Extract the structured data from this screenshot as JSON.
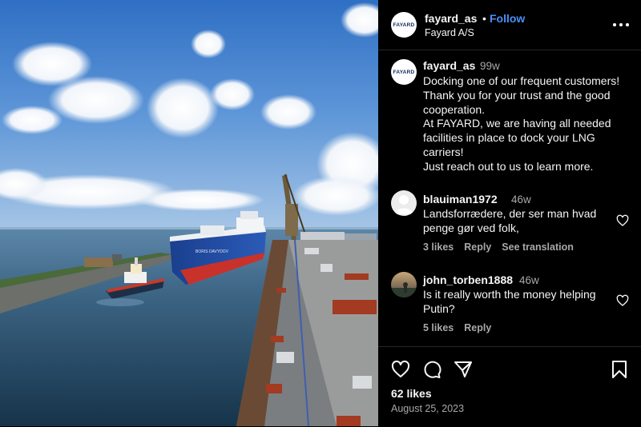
{
  "post": {
    "username": "fayard_as",
    "separator": "•",
    "follow_label": "Follow",
    "subtitle": "Fayard A/S",
    "avatar_text": "FAYARD",
    "photo_ship_name": "BORIS DAVYDOV"
  },
  "caption": {
    "username": "fayard_as",
    "time": "99w",
    "lines": [
      "Docking one of our frequent customers!",
      "Thank you for your trust and the good",
      "cooperation.",
      "At FAYARD, we are having all needed",
      "facilities in place to dock your LNG",
      "carriers!",
      "Just reach out to us to learn more."
    ]
  },
  "comments": [
    {
      "username": "blauiman1972",
      "time": "46w",
      "lines": [
        "Landsforrædere, der ser man hvad",
        "penge gør ved folk,"
      ],
      "likes": "3 likes",
      "reply": "Reply",
      "translate": "See translation"
    },
    {
      "username": "john_torben1888",
      "time": "46w",
      "lines": [
        "Is it really worth the money helping",
        "Putin?"
      ],
      "likes": "5 likes",
      "reply": "Reply"
    }
  ],
  "footer": {
    "likes": "62 likes",
    "date": "August 25, 2023"
  },
  "colors": {
    "background": "#000000",
    "follow": "#4a8ff7",
    "muted": "#a8a8a8",
    "divider": "#262626"
  },
  "icons": [
    "more-icon",
    "heart-icon",
    "comment-icon",
    "share-icon",
    "bookmark-icon"
  ]
}
